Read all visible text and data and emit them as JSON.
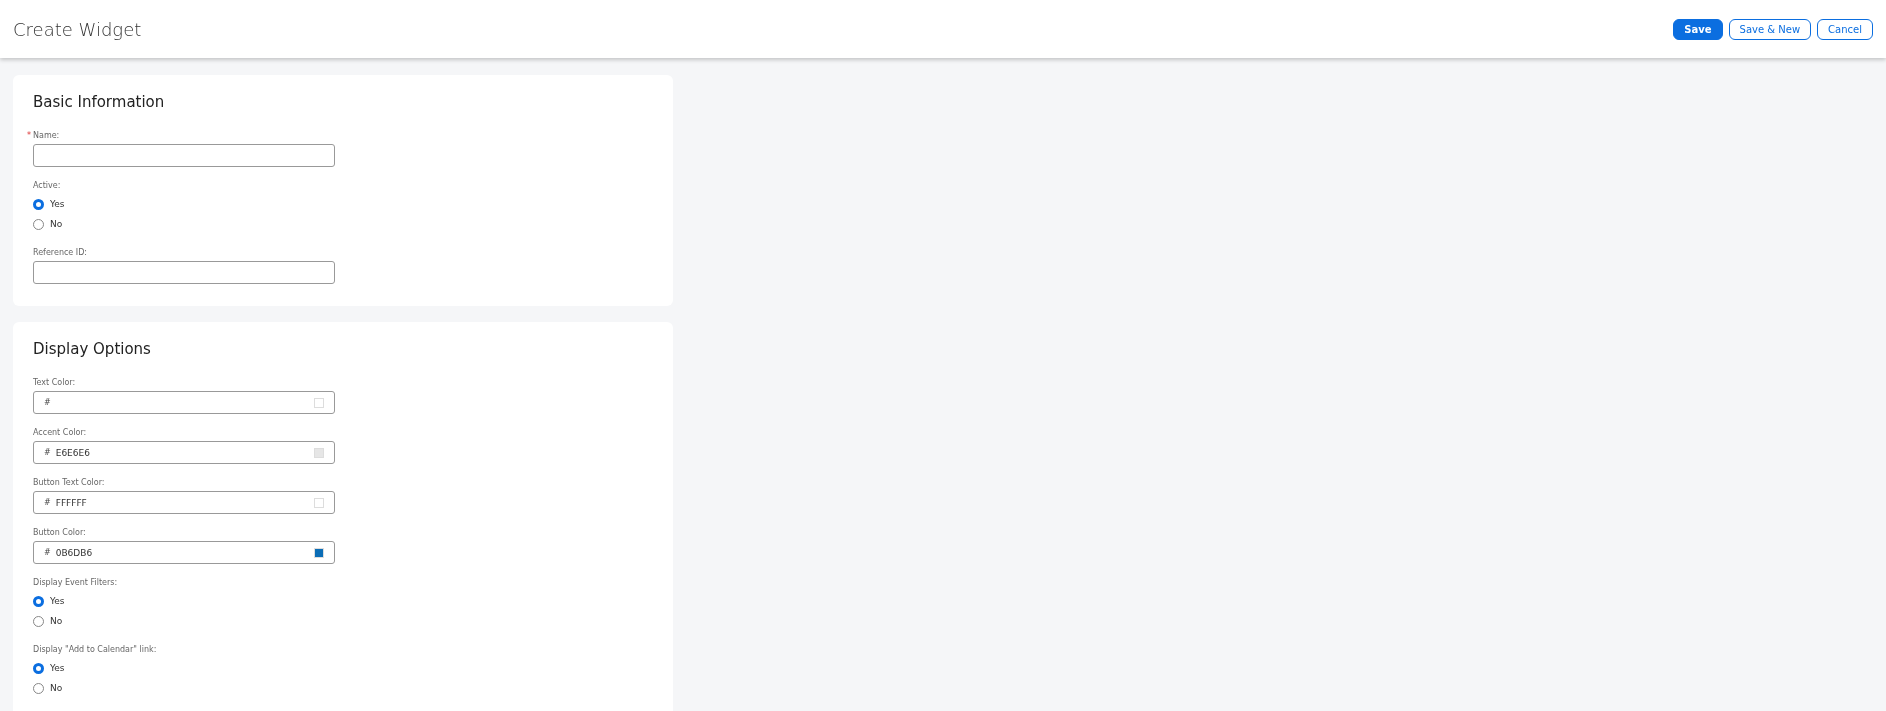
{
  "header": {
    "title": "Create Widget",
    "buttons": [
      {
        "label": "Save",
        "kind": "primary"
      },
      {
        "label": "Save & New",
        "kind": "secondary"
      },
      {
        "label": "Cancel",
        "kind": "secondary"
      }
    ]
  },
  "sections": [
    {
      "title": "Basic Information",
      "fields": [
        {
          "kind": "text",
          "label": "Name:",
          "required_mark": "*"
        },
        {
          "kind": "radio",
          "label": "Active:",
          "options": [
            {
              "label": "Yes",
              "selected": true
            },
            {
              "label": "No",
              "selected": false
            }
          ]
        },
        {
          "kind": "text",
          "label": "Reference ID:"
        }
      ]
    },
    {
      "title": "Display Options",
      "fields": [
        {
          "kind": "color",
          "label": "Text Color:",
          "prefix": "#"
        },
        {
          "kind": "color",
          "label": "Accent Color:",
          "prefix": "#",
          "value": "E6E6E6"
        },
        {
          "kind": "color",
          "label": "Button Text Color:",
          "prefix": "#",
          "value": "FFFFFF"
        },
        {
          "kind": "color",
          "label": "Button Color:",
          "prefix": "#",
          "value": "0B6DB6"
        },
        {
          "kind": "radio",
          "label": "Display Event Filters:",
          "options": [
            {
              "label": "Yes",
              "selected": true
            },
            {
              "label": "No",
              "selected": false
            }
          ]
        },
        {
          "kind": "radio",
          "label": "Display \"Add to Calendar\" link:",
          "options": [
            {
              "label": "Yes",
              "selected": true
            },
            {
              "label": "No",
              "selected": false
            }
          ]
        }
      ]
    }
  ]
}
